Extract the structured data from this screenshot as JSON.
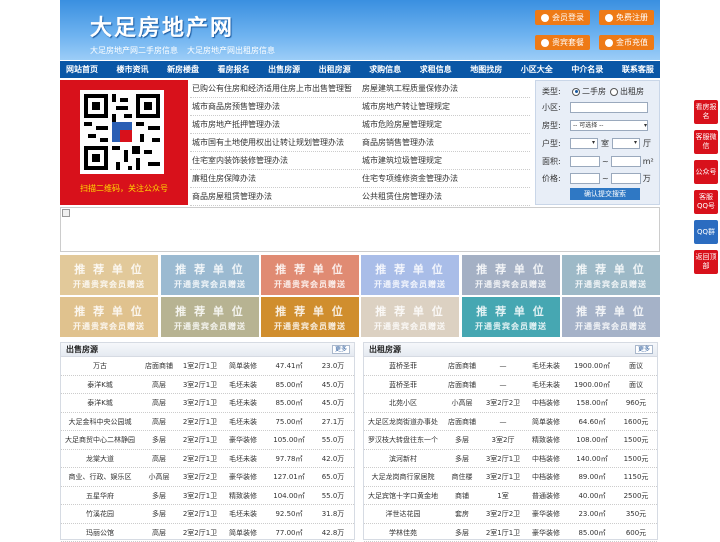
{
  "header": {
    "logo": "大足房地产网",
    "sub1": "大足房地产网二手房信息",
    "sub2": "大足房地产网出租房信息",
    "buttons": [
      "会员登录",
      "免费注册",
      "贵宾套餐",
      "金币充值"
    ]
  },
  "nav": [
    "网站首页",
    "楼市资讯",
    "新房楼盘",
    "看房报名",
    "出售房源",
    "出租房源",
    "求购信息",
    "求租信息",
    "地图找房",
    "小区大全",
    "中介名录",
    "联系客服"
  ],
  "qr": {
    "caption": "扫描二维码，关注公众号"
  },
  "links": [
    [
      "已购公有住房和经济适用住房上市出售管理暂",
      "房屋建筑工程质量保修办法"
    ],
    [
      "城市商品房预售管理办法",
      "城市房地产转让管理规定"
    ],
    [
      "城市房地产抵押管理办法",
      "城市危险房屋管理规定"
    ],
    [
      "城市国有土地使用权出让转让规划管理办法",
      "商品房销售管理办法"
    ],
    [
      "住宅室内装饰装修管理办法",
      "城市建筑垃圾管理规定"
    ],
    [
      "廉租住房保障办法",
      "住宅专项维修资金管理办法"
    ],
    [
      "商品房屋租赁管理办法",
      "公共租赁住房管理办法"
    ]
  ],
  "search": {
    "type_label": "类型:",
    "opt1": "二手房",
    "opt2": "出租房",
    "community_label": "小区:",
    "housetype_label": "房型:",
    "housetype_value": "-- 可选择 --",
    "layout_label": "户型:",
    "room": "室",
    "hall": "厅",
    "area_label": "面积:",
    "area_unit": "m²",
    "price_label": "价格:",
    "price_unit": "万",
    "tilde": "~",
    "submit": "确认提交搜索"
  },
  "tiles": {
    "line1": "推 荐 单 位",
    "line2": "开通贵宾会员赠送",
    "colors": [
      "#e2c99a",
      "#9bbad1",
      "#e08b73",
      "#a9bde8",
      "#a4b0c4",
      "#9db9c7",
      "#e0c28e",
      "#b7b392",
      "#d08e2e",
      "#dcd1c2",
      "#46a7b2",
      "#a5b2c8"
    ]
  },
  "sale": {
    "title": "出售房源",
    "more": "更多",
    "rows": [
      [
        "万古",
        "店面商铺",
        "1室2厅1卫",
        "简单装修",
        "47.41㎡",
        "23.0万"
      ],
      [
        "泰洋K城",
        "高层",
        "3室2厅1卫",
        "毛坯未装",
        "85.00㎡",
        "45.0万"
      ],
      [
        "泰洋K城",
        "高层",
        "3室2厅1卫",
        "毛坯未装",
        "85.00㎡",
        "45.0万"
      ],
      [
        "大足金科中央公园城",
        "高层",
        "2室2厅1卫",
        "毛坯未装",
        "75.00㎡",
        "27.1万"
      ],
      [
        "大足商贸中心二林静园",
        "多层",
        "2室2厅1卫",
        "豪华装修",
        "105.00㎡",
        "55.0万"
      ],
      [
        "龙棠大道",
        "高层",
        "2室2厅1卫",
        "毛坯未装",
        "97.78㎡",
        "42.0万"
      ],
      [
        "商业、行政、娱乐区",
        "小高层",
        "3室2厅2卫",
        "豪华装修",
        "127.01㎡",
        "65.0万"
      ],
      [
        "五星华府",
        "多层",
        "3室2厅1卫",
        "精致装修",
        "104.00㎡",
        "55.0万"
      ],
      [
        "竹溪花园",
        "多层",
        "2室2厅1卫",
        "毛坯未装",
        "92.50㎡",
        "31.8万"
      ],
      [
        "玛丽公馆",
        "高层",
        "2室2厅1卫",
        "简单装修",
        "77.00㎡",
        "42.8万"
      ]
    ]
  },
  "rent": {
    "title": "出租房源",
    "more": "更多",
    "rows": [
      [
        "蓝桥圣菲",
        "店面商铺",
        "—",
        "毛坯未装",
        "1900.00㎡",
        "面议"
      ],
      [
        "蓝桥圣菲",
        "店面商铺",
        "—",
        "毛坯未装",
        "1900.00㎡",
        "面议"
      ],
      [
        "北苑小区",
        "小高层",
        "3室2厅2卫",
        "中档装修",
        "158.00㎡",
        "960元"
      ],
      [
        "大足区龙岗街道办事处",
        "店面商铺",
        "—",
        "简单装修",
        "64.60㎡",
        "1600元"
      ],
      [
        "罗汉枝大转盘往东一个",
        "多层",
        "3室2厅",
        "精致装修",
        "108.00㎡",
        "1500元"
      ],
      [
        "滨河新村",
        "多层",
        "3室2厅1卫",
        "中档装修",
        "140.00㎡",
        "1500元"
      ],
      [
        "大足龙岗商行家居院",
        "商住楼",
        "3室2厅1卫",
        "中档装修",
        "89.00㎡",
        "1150元"
      ],
      [
        "大足宾馆十字口黄金地",
        "商铺",
        "1室",
        "普通装修",
        "40.00㎡",
        "2500元"
      ],
      [
        "洋世达花园",
        "套房",
        "3室2厅2卫",
        "豪华装修",
        "23.00㎡",
        "350元"
      ],
      [
        "学林佳苑",
        "多层",
        "2室1厅1卫",
        "豪华装修",
        "85.00㎡",
        "600元"
      ]
    ]
  },
  "side": [
    "看房报名",
    "客服微信",
    "公众号",
    "客服QQ号",
    "QQ群",
    "返回顶部"
  ]
}
